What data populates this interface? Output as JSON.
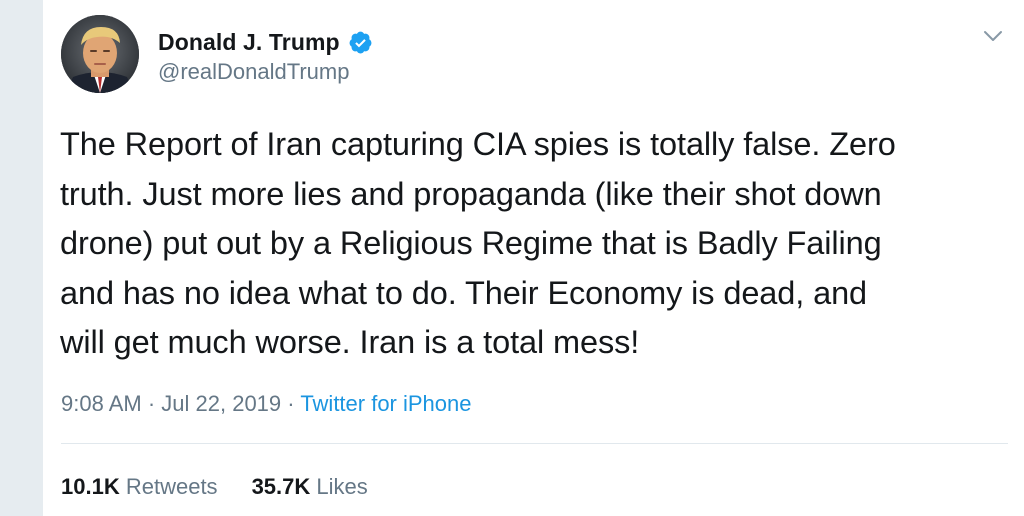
{
  "author": {
    "display_name": "Donald J. Trump",
    "handle": "@realDonaldTrump",
    "verified": true
  },
  "tweet": {
    "text": "The Report of Iran capturing CIA spies is totally false. Zero\ntruth. Just more lies and propaganda (like their shot down\ndrone) put out by a Religious Regime that is Badly Failing\nand has no idea what to do. Their Economy is dead, and\nwill get much worse. Iran is a total mess!"
  },
  "meta": {
    "time": "9:08 AM",
    "separator": " · ",
    "date": "Jul 22, 2019",
    "source": "Twitter for iPhone"
  },
  "stats": {
    "retweets_count": "10.1K",
    "retweets_label": "Retweets",
    "likes_count": "35.7K",
    "likes_label": "Likes"
  },
  "icons": {
    "verified": "verified-badge-icon",
    "caret": "chevron-down-icon"
  },
  "colors": {
    "text": "#14171a",
    "secondary": "#657786",
    "link": "#1b95e0",
    "verified": "#1da1f2",
    "divider": "#e1e8ed",
    "gutter": "#e6ecf0"
  }
}
